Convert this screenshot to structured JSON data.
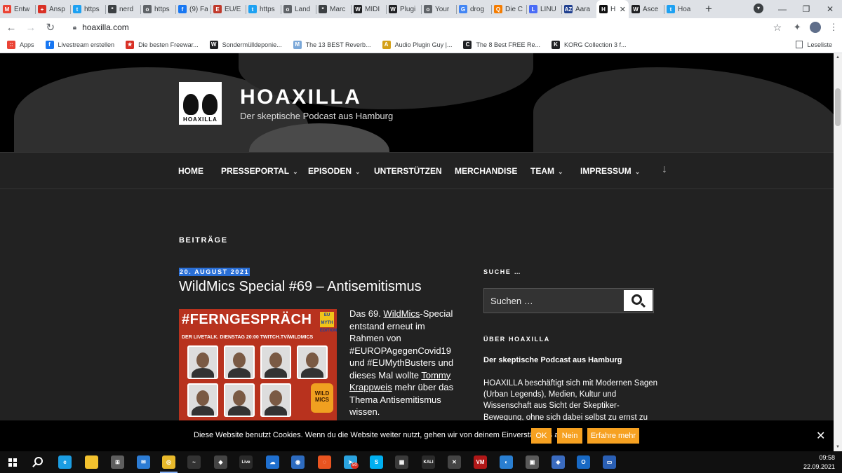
{
  "browser": {
    "tabs": [
      {
        "label": "Entw",
        "icon": "gmail-icon",
        "color": "#ea4335",
        "glyph": "M"
      },
      {
        "label": "Ansp",
        "icon": "shield-icon",
        "color": "#d93025",
        "glyph": "+"
      },
      {
        "label": "https",
        "icon": "twitter-icon",
        "color": "#1da1f2",
        "glyph": "t"
      },
      {
        "label": "nerd",
        "icon": "star-circle-icon",
        "color": "#3c4043",
        "glyph": "*"
      },
      {
        "label": "https",
        "icon": "globe-icon",
        "color": "#5f6368",
        "glyph": "o"
      },
      {
        "label": "(9) Fa",
        "icon": "facebook-icon",
        "color": "#1877f2",
        "glyph": "f"
      },
      {
        "label": "EU/E",
        "icon": "flag-icon",
        "color": "#c0392b",
        "glyph": "E"
      },
      {
        "label": "https",
        "icon": "twitter-icon",
        "color": "#1da1f2",
        "glyph": "t"
      },
      {
        "label": "Land",
        "icon": "globe-icon",
        "color": "#5f6368",
        "glyph": "o"
      },
      {
        "label": "Marc",
        "icon": "star-circle-icon",
        "color": "#3c4043",
        "glyph": "*"
      },
      {
        "label": "MIDI",
        "icon": "wiki-icon",
        "color": "#202124",
        "glyph": "W"
      },
      {
        "label": "Plugi",
        "icon": "wiki-icon",
        "color": "#202124",
        "glyph": "W"
      },
      {
        "label": "Your",
        "icon": "globe-icon",
        "color": "#5f6368",
        "glyph": "o"
      },
      {
        "label": "drog",
        "icon": "google-icon",
        "color": "#4285f4",
        "glyph": "G"
      },
      {
        "label": "Die C",
        "icon": "orange-app-icon",
        "color": "#f57c00",
        "glyph": "Q"
      },
      {
        "label": "LINU",
        "icon": "people-icon",
        "color": "#4a6cf7",
        "glyph": "L"
      },
      {
        "label": "Aara",
        "icon": "az-icon",
        "color": "#1f3f8f",
        "glyph": "AZ"
      },
      {
        "label": "H",
        "icon": "hoaxilla-icon",
        "color": "#111111",
        "glyph": "H",
        "active": true
      },
      {
        "label": "Asce",
        "icon": "wiki-icon",
        "color": "#202124",
        "glyph": "W"
      },
      {
        "label": "Hoa",
        "icon": "twitter-icon",
        "color": "#1da1f2",
        "glyph": "t"
      }
    ],
    "url": "hoaxilla.com",
    "bookmarks": [
      {
        "label": "Apps",
        "icon": "apps-grid-icon",
        "color": "#ea4335",
        "glyph": "::"
      },
      {
        "label": "Livestream erstellen",
        "icon": "facebook-icon",
        "color": "#1877f2",
        "glyph": "f"
      },
      {
        "label": "Die besten Freewar...",
        "icon": "star-icon",
        "color": "#d93025",
        "glyph": "★"
      },
      {
        "label": "Sondermülldeponie...",
        "icon": "wiki-icon",
        "color": "#202124",
        "glyph": "W"
      },
      {
        "label": "The 13 BEST Reverb...",
        "icon": "music-icon",
        "color": "#7aa7d8",
        "glyph": "M"
      },
      {
        "label": "Audio Plugin Guy |...",
        "icon": "audio-icon",
        "color": "#d4a017",
        "glyph": "A"
      },
      {
        "label": "The 8 Best FREE Re...",
        "icon": "moon-icon",
        "color": "#202124",
        "glyph": "C"
      },
      {
        "label": "KORG Collection 3 f...",
        "icon": "korg-icon",
        "color": "#202124",
        "glyph": "K"
      }
    ],
    "reading_list": "Leseliste"
  },
  "site": {
    "logo_text": "HOAXILLA",
    "title": "HOAXILLA",
    "tagline": "Der skeptische Podcast aus Hamburg"
  },
  "nav": [
    {
      "label": "HOME",
      "dropdown": false
    },
    {
      "label": "PRESSEPORTAL",
      "dropdown": true
    },
    {
      "label": "EPISODEN",
      "dropdown": true
    },
    {
      "label": "UNTERSTÜTZEN",
      "dropdown": false
    },
    {
      "label": "MERCHANDISE",
      "dropdown": false
    },
    {
      "label": "TEAM",
      "dropdown": true
    },
    {
      "label": "IMPRESSUM",
      "dropdown": true
    }
  ],
  "main": {
    "section_heading": "BEITRÄGE",
    "post": {
      "date": "20. AUGUST 2021",
      "title": "WildMics Special #69 – Antisemitismus",
      "image": {
        "headline": "#FERNGESPRÄCH",
        "badge": "EU MYTH EDITION",
        "subline": "DER LIVETALK. DIENSTAG 20:00 TWITCH.TV/WILDMICS",
        "logo": "WILD MICS"
      },
      "excerpt": {
        "t1": "Das 69. ",
        "link1": "WildMics",
        "t2": "-Special entstand erneut im Rahmen von #EUROPAgegenCovid19 und #EUMythBusters und dieses Mal wollte ",
        "link2": "Tommy Krappweis",
        "t3": " mehr über das Thema Antisemitismus wissen."
      }
    }
  },
  "sidebar": {
    "search_heading": "SUCHE …",
    "search_placeholder": "Suchen …",
    "about_heading": "ÜBER HOAXILLA",
    "about_subtitle": "Der skeptische Podcast aus Hamburg",
    "about_text": "HOAXILLA beschäftigt sich mit Modernen Sagen (Urban Legends), Medien, Kultur und Wissenschaft aus Sicht der Skeptiker-Bewegung, ohne sich dabei selbst zu ernst zu nehmen."
  },
  "cookie": {
    "text": "Diese Website benutzt Cookies. Wenn du die Website weiter nutzt, gehen wir von deinem Einverständnis aus.",
    "ok": "OK",
    "no": "Nein",
    "more": "Erfahre mehr"
  },
  "taskbar": {
    "apps": [
      {
        "name": "edge-icon",
        "color": "#1b9de2",
        "glyph": "e"
      },
      {
        "name": "file-explorer-icon",
        "color": "#f2c12e",
        "glyph": ""
      },
      {
        "name": "store-icon",
        "color": "#5e5e5e",
        "glyph": "⊞"
      },
      {
        "name": "mail-icon",
        "color": "#2c7cd4",
        "glyph": "✉"
      },
      {
        "name": "chrome-icon",
        "color": "#e8b92b",
        "glyph": "◎",
        "active": true
      },
      {
        "name": "resolume-icon",
        "color": "#333333",
        "glyph": "~"
      },
      {
        "name": "inkscape-icon",
        "color": "#444444",
        "glyph": "◆"
      },
      {
        "name": "ableton-live-icon",
        "color": "#2a2a2a",
        "glyph": "Live"
      },
      {
        "name": "onedrive-icon",
        "color": "#1f6fcf",
        "glyph": "☁"
      },
      {
        "name": "camera-icon",
        "color": "#2d6bbf",
        "glyph": "◉"
      },
      {
        "name": "ubuntu-icon",
        "color": "#e95420",
        "glyph": "◌"
      },
      {
        "name": "telegram-icon",
        "color": "#2aa3df",
        "glyph": "➤"
      },
      {
        "name": "skype-icon",
        "color": "#00aff0",
        "glyph": "S"
      },
      {
        "name": "calculator-icon",
        "color": "#3a3a3a",
        "glyph": "▦"
      },
      {
        "name": "kali-icon",
        "color": "#2b2b2b",
        "glyph": "KALI"
      },
      {
        "name": "x-app-icon",
        "color": "#444444",
        "glyph": "✕"
      },
      {
        "name": "voicemeeter-icon",
        "color": "#b01818",
        "glyph": "VM"
      },
      {
        "name": "chat-icon",
        "color": "#2a7fd1",
        "glyph": "◐"
      },
      {
        "name": "monitor-icon",
        "color": "#5a5a5a",
        "glyph": "▣"
      },
      {
        "name": "cube-icon",
        "color": "#3a6bbf",
        "glyph": "◈"
      },
      {
        "name": "outlook-icon",
        "color": "#1869c4",
        "glyph": "O"
      },
      {
        "name": "window-app-icon",
        "color": "#2a5fb4",
        "glyph": "▭"
      }
    ],
    "badge": "50",
    "time": "09:58",
    "date": "22.09.2021"
  }
}
